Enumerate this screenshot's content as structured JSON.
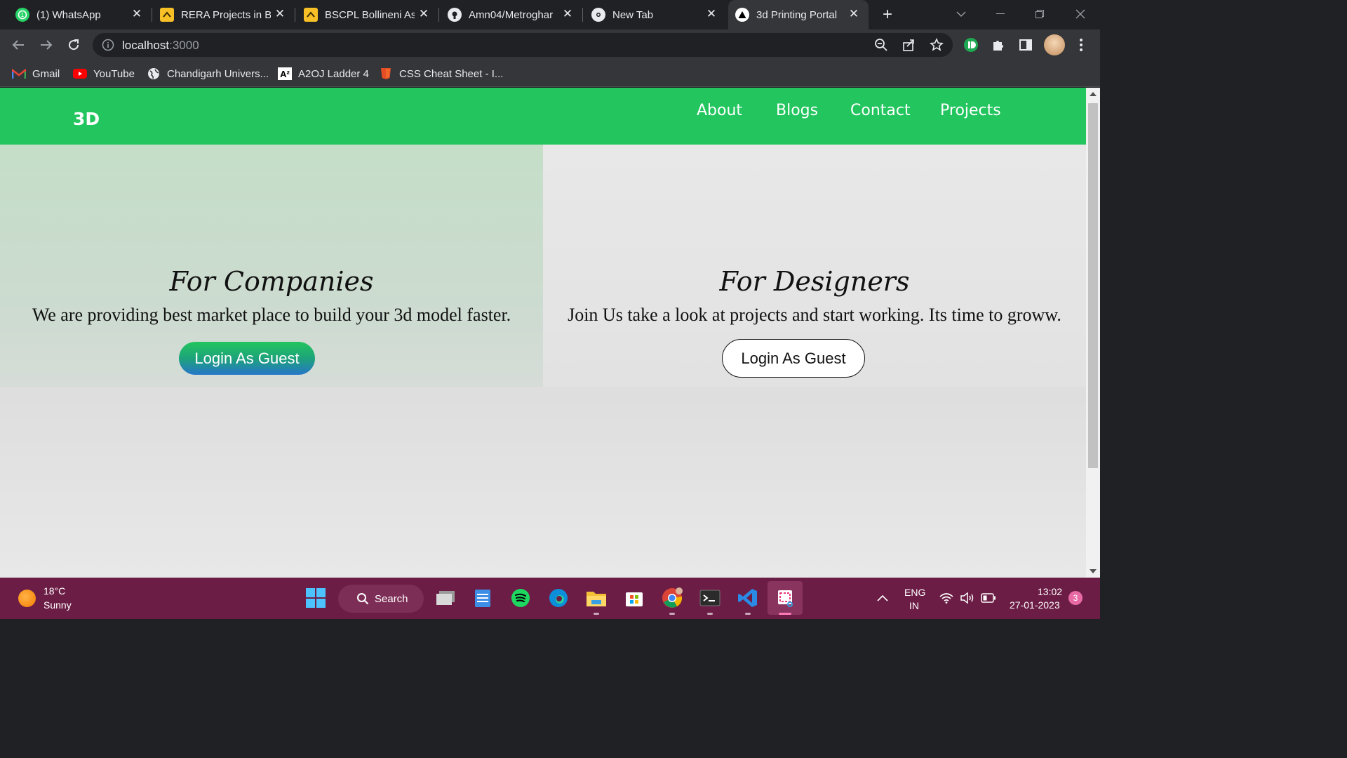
{
  "browser": {
    "tabs": [
      {
        "title": "(1) WhatsApp",
        "icon": "whatsapp-icon"
      },
      {
        "title": "RERA Projects in Ba",
        "icon": "rera-icon"
      },
      {
        "title": "BSCPL Bollineni Ast",
        "icon": "rera-icon"
      },
      {
        "title": "Amn04/Metroghar",
        "icon": "github-icon"
      },
      {
        "title": "New Tab",
        "icon": "chrome-icon"
      },
      {
        "title": "3d Printing Portal",
        "icon": "triangle-icon",
        "active": true
      }
    ],
    "new_tab": "+",
    "url_host": "localhost",
    "url_port": ":3000",
    "bookmarks": [
      {
        "label": "Gmail",
        "icon": "gmail-icon"
      },
      {
        "label": "YouTube",
        "icon": "youtube-icon"
      },
      {
        "label": "Chandigarh Univers...",
        "icon": "globe-icon"
      },
      {
        "label": "A2OJ Ladder 4",
        "icon": "a2oj-icon"
      },
      {
        "label": "CSS Cheat Sheet - I...",
        "icon": "css-icon"
      }
    ]
  },
  "site": {
    "logo": "3D",
    "nav": [
      "About",
      "Blogs",
      "Contact",
      "Projects"
    ],
    "companies": {
      "heading": "For Companies",
      "text": "We are providing best market place to build your 3d model faster.",
      "button": "Login As Guest"
    },
    "designers": {
      "heading": "For Designers",
      "text": "Join Us take a look at projects and start working. Its time to groww.",
      "button": "Login As Guest"
    },
    "colors": {
      "nav_green": "#22c55e",
      "gradient_end": "#2576c9"
    }
  },
  "taskbar": {
    "temperature": "18°C",
    "weather": "Sunny",
    "search": "Search",
    "language": "ENG",
    "region": "IN",
    "time": "13:02",
    "date": "27-01-2023",
    "notifications": "3"
  }
}
